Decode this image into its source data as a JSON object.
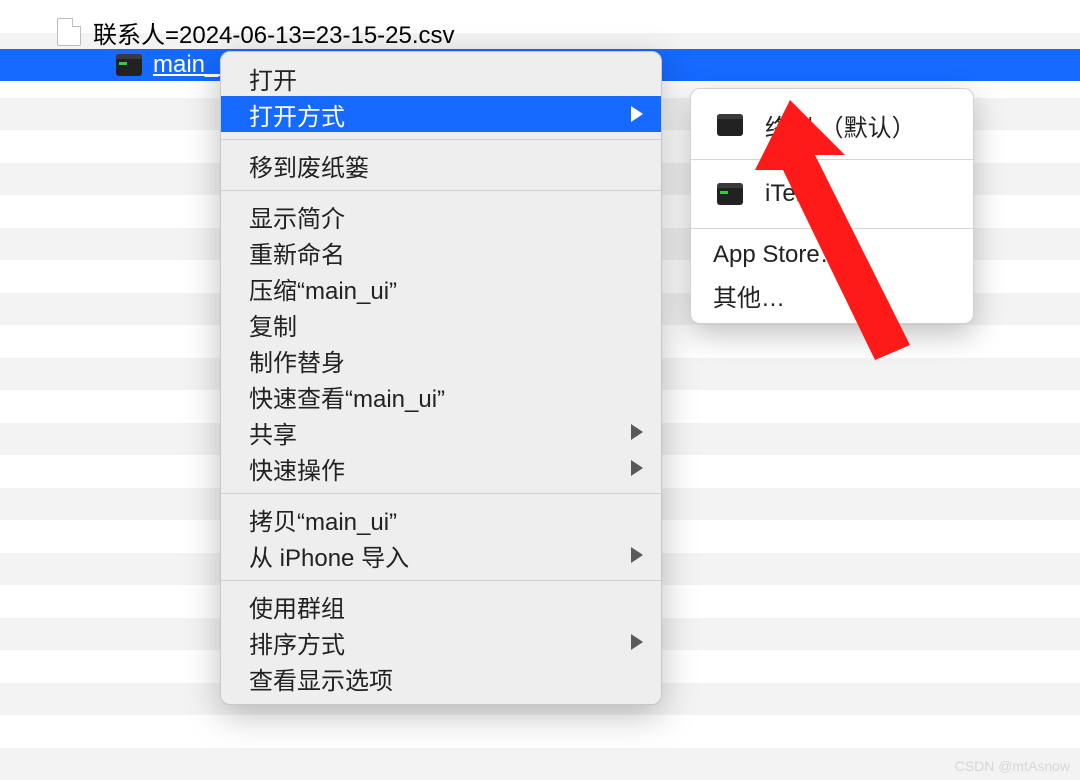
{
  "files": {
    "csv": {
      "name": "联系人=2024-06-13=23-15-25.csv"
    },
    "selected": {
      "name": "main_ui"
    }
  },
  "context_menu": {
    "open": "打开",
    "open_with": "打开方式",
    "trash": "移到废纸篓",
    "get_info": "显示简介",
    "rename": "重新命名",
    "compress": "压缩“main_ui”",
    "duplicate": "复制",
    "alias": "制作替身",
    "quick_look": "快速查看“main_ui”",
    "share": "共享",
    "quick_actions": "快速操作",
    "copy": "拷贝“main_ui”",
    "import_iphone": "从 iPhone 导入",
    "use_groups": "使用群组",
    "sort_by": "排序方式",
    "view_options": "查看显示选项"
  },
  "submenu": {
    "terminal_default": "终端 （默认）",
    "iterm": "iTerm",
    "app_store": "App Store…",
    "other": "其他…"
  },
  "watermark": "CSDN @mtAsnow"
}
